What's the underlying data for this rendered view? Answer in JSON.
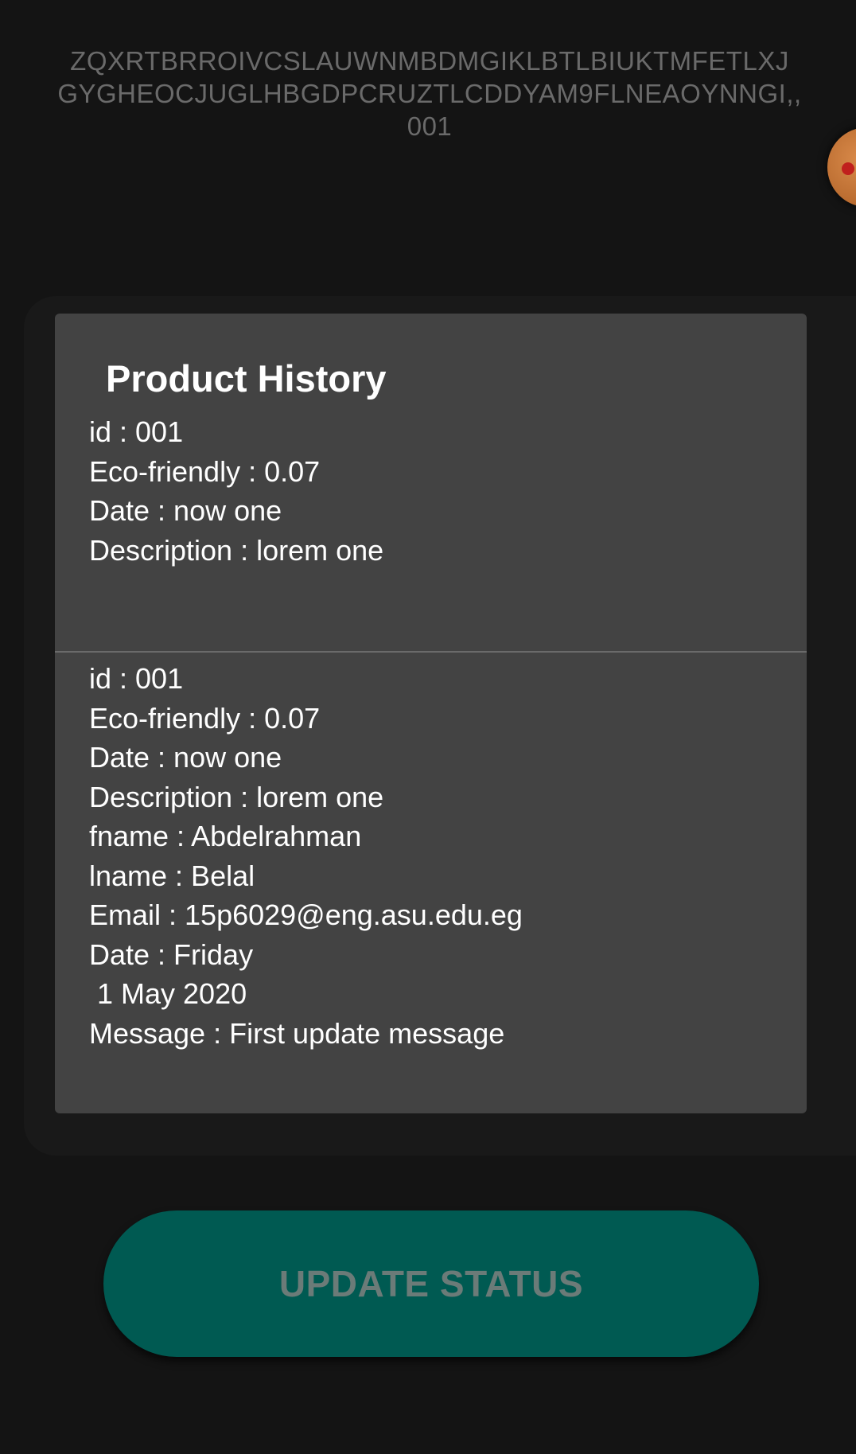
{
  "header": {
    "hash_lines": [
      "ZQXRTBRROIVCSLAUWNMBDMGIKLBTLBIUKTMFETLXJ",
      "GYGHEOCJUGLHBGDPCRUZTLCDDYAM9FLNEAOYNNGI,,",
      "001"
    ]
  },
  "dialog": {
    "title": "Product History",
    "records": [
      {
        "lines": [
          "id : 001",
          "Eco-friendly : 0.07",
          "Date : now one",
          "Description : lorem one"
        ]
      },
      {
        "lines": [
          "id : 001",
          "Eco-friendly : 0.07",
          "Date : now one",
          "Description : lorem one",
          "fname : Abdelrahman",
          "lname : Belal",
          "Email : 15p6029@eng.asu.edu.eg",
          "Date : Friday",
          " 1 May 2020",
          "Message : First update message"
        ]
      }
    ]
  },
  "actions": {
    "update_label": "UPDATE STATUS"
  },
  "colors": {
    "background": "#141414",
    "dialog": "#434343",
    "button": "#005a52",
    "button_text": "#6b7b78",
    "hash_text": "#6a6a6a"
  }
}
